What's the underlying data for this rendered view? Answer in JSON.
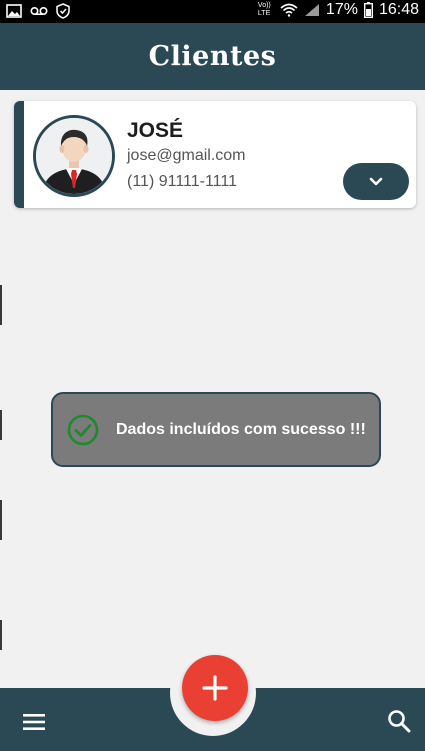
{
  "status_bar": {
    "lte_label": "Vo)) LTE",
    "battery_percent": "17%",
    "time": "16:48",
    "icons": [
      "image-icon",
      "voicemail-icon",
      "shield-icon",
      "wifi-icon",
      "signal-icon",
      "battery-icon"
    ]
  },
  "header": {
    "title": "Clientes"
  },
  "clients": [
    {
      "name": "JOSÉ",
      "email": "jose@gmail.com",
      "phone": "(11) 91111-1111",
      "avatar_icon": "businessman-avatar"
    }
  ],
  "toast": {
    "message": "Dados incluídos com sucesso !!!",
    "icon": "check-circle-icon"
  },
  "bottom_nav": {
    "fab_icon": "plus-icon",
    "left_icon": "menu-icon",
    "right_icon": "search-icon"
  },
  "colors": {
    "primary": "#2b4954",
    "fab": "#ea3f33",
    "background": "#f1f1f1",
    "toast_bg": "#7b7b7b",
    "check": "#1e8a2e"
  }
}
